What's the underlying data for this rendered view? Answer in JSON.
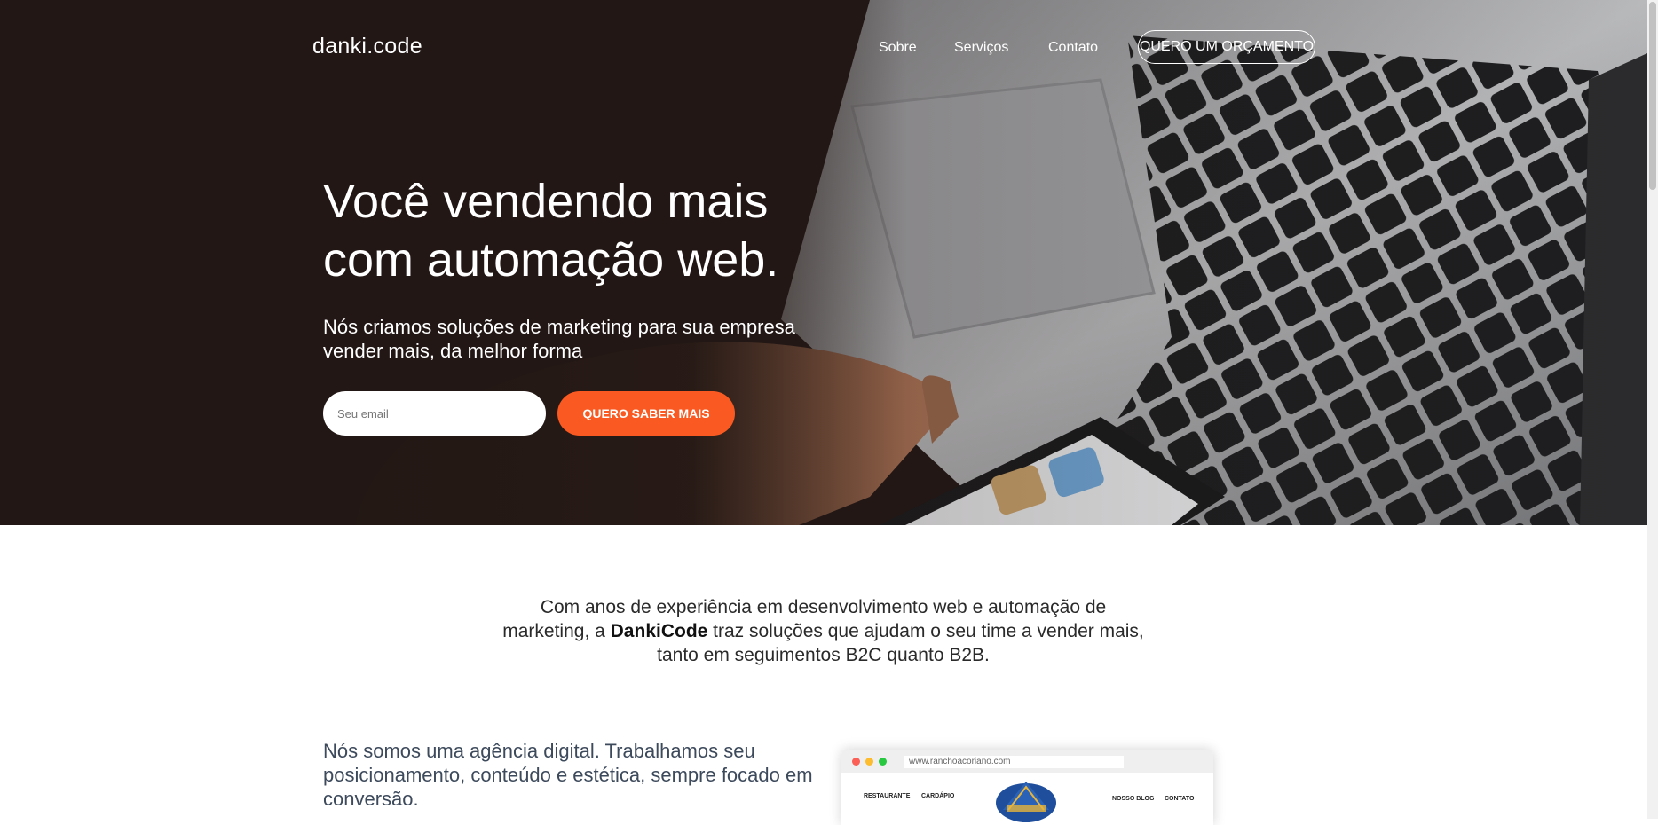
{
  "nav": {
    "logo": "danki.code",
    "links": [
      "Sobre",
      "Serviços",
      "Contato"
    ],
    "cta": "QUERO UM ORÇAMENTO"
  },
  "hero": {
    "title_line1": "Você vendendo mais",
    "title_line2": "com automação web.",
    "subtitle_line1": "Nós criamos soluções de marketing para sua empresa",
    "subtitle_line2": "vender mais, da melhor forma",
    "email_placeholder": "Seu email",
    "button": "QUERO SABER MAIS"
  },
  "intro": {
    "text_before": "Com anos de experiência em desenvolvimento web e automação de marketing, a ",
    "brand": "DankiCode",
    "text_after": " traz soluções que ajudam o seu time a vender mais, tanto em seguimentos B2C quanto B2B."
  },
  "about": {
    "text": "Nós somos uma agência digital. Trabalhamos seu posicionamento, conteúdo e estética, sempre focado em conversão."
  },
  "mockup": {
    "url": "www.ranchoacoriano.com",
    "nav_left": [
      "RESTAURANTE",
      "CARDÁPIO"
    ],
    "nav_right": [
      "NOSSO BLOG",
      "CONTATO"
    ]
  },
  "colors": {
    "accent": "#fa5a22",
    "hero_dark": "#221714",
    "about_text": "#3d4a5c"
  }
}
